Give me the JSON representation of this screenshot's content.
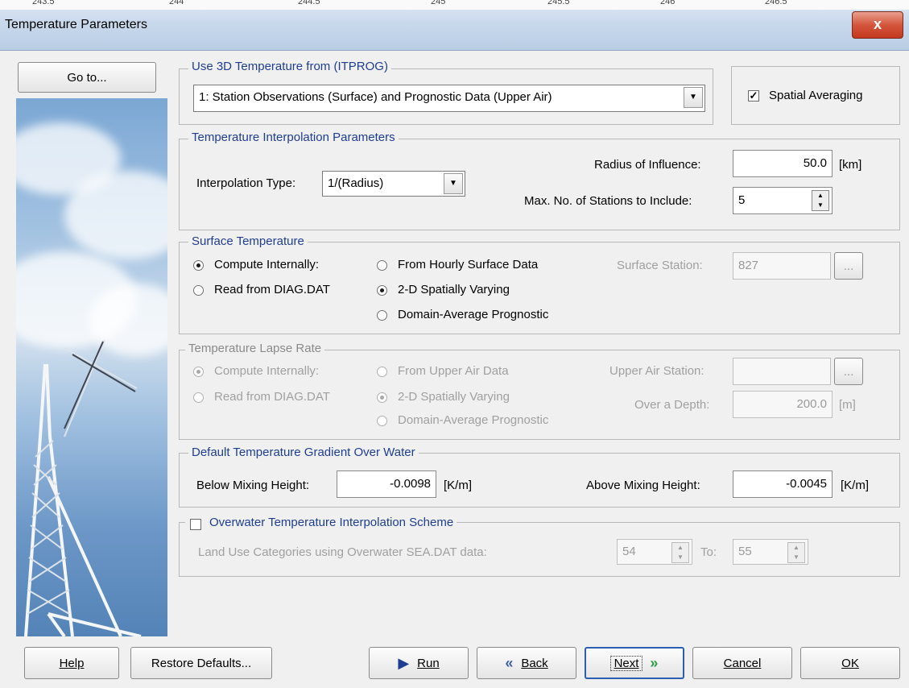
{
  "window": {
    "title": "Temperature Parameters",
    "close_glyph": "x",
    "background_axis_labels": [
      "243.5",
      "244",
      "244.5",
      "245",
      "245.5",
      "246",
      "246.5"
    ]
  },
  "left_panel": {
    "goto_label": "Go to..."
  },
  "use3d": {
    "legend": "Use 3D Temperature from (ITPROG)",
    "selected": "1: Station Observations (Surface) and Prognostic Data (Upper Air)",
    "spatial_averaging_label": "Spatial Averaging",
    "spatial_averaging_checked": true
  },
  "interp": {
    "legend": "Temperature Interpolation Parameters",
    "type_label": "Interpolation Type:",
    "type_value": "1/(Radius)",
    "radius_label": "Radius of Influence:",
    "radius_value": "50.0",
    "radius_unit": "[km]",
    "max_stations_label": "Max. No. of Stations to Include:",
    "max_stations_value": "5"
  },
  "surface": {
    "legend": "Surface Temperature",
    "compute_label": "Compute Internally:",
    "read_label": "Read from DIAG.DAT",
    "hourly_label": "From Hourly Surface Data",
    "spatial_label": "2-D Spatially Varying",
    "domain_label": "Domain-Average Prognostic",
    "station_label": "Surface Station:",
    "station_value": "827",
    "browse_label": "..."
  },
  "lapse": {
    "legend": "Temperature Lapse Rate",
    "compute_label": "Compute Internally:",
    "read_label": "Read from DIAG.DAT",
    "upper_label": "From Upper Air Data",
    "spatial_label": "2-D Spatially Varying",
    "domain_label": "Domain-Average Prognostic",
    "station_label": "Upper Air Station:",
    "station_value": "",
    "browse_label": "...",
    "depth_label": "Over a Depth:",
    "depth_value": "200.0",
    "depth_unit": "[m]"
  },
  "gradient": {
    "legend": "Default Temperature Gradient Over Water",
    "below_label": "Below Mixing Height:",
    "below_value": "-0.0098",
    "below_unit": "[K/m]",
    "above_label": "Above Mixing Height:",
    "above_value": "-0.0045",
    "above_unit": "[K/m]"
  },
  "overwater": {
    "legend": "Overwater Temperature Interpolation Scheme",
    "checked": false,
    "land_use_label": "Land Use Categories using Overwater SEA.DAT data:",
    "from_value": "54",
    "to_label": "To:",
    "to_value": "55"
  },
  "buttons": {
    "help": "Help",
    "restore": "Restore Defaults...",
    "run": "Run",
    "back": "Back",
    "next": "Next",
    "cancel": "Cancel",
    "ok": "OK"
  }
}
